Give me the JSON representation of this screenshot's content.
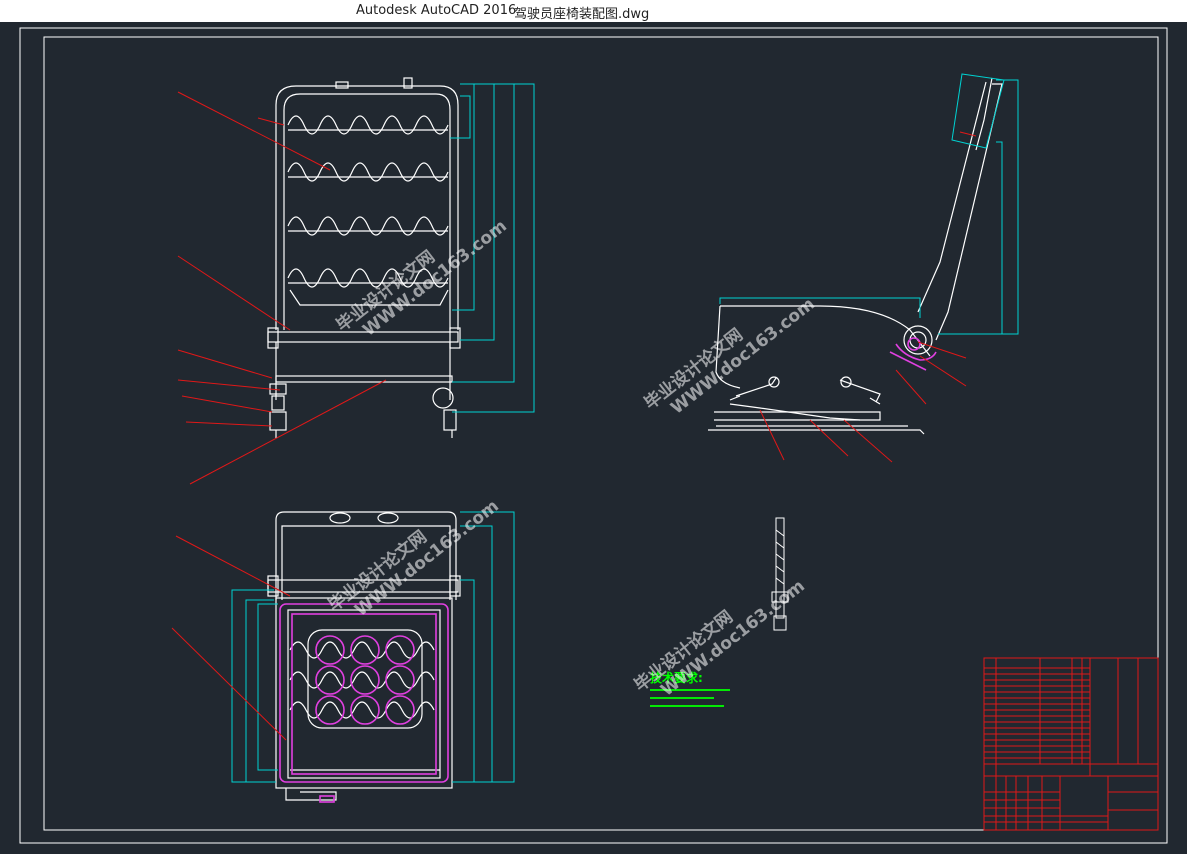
{
  "window": {
    "app_title": "Autodesk AutoCAD 2016",
    "file_name": "驾驶员座椅装配图.dwg"
  },
  "colors": {
    "canvas_bg": "#212830",
    "geometry": "#ffffff",
    "leader": "#e01818",
    "dimension": "#00d2d2",
    "highlight": "#e040e0",
    "text_green": "#00ff00",
    "table": "#e01818"
  },
  "watermark": {
    "cn": "毕业设计论文网",
    "url": "WWW.doc163.com"
  },
  "tech_requirements": {
    "title": "技术要求:"
  }
}
